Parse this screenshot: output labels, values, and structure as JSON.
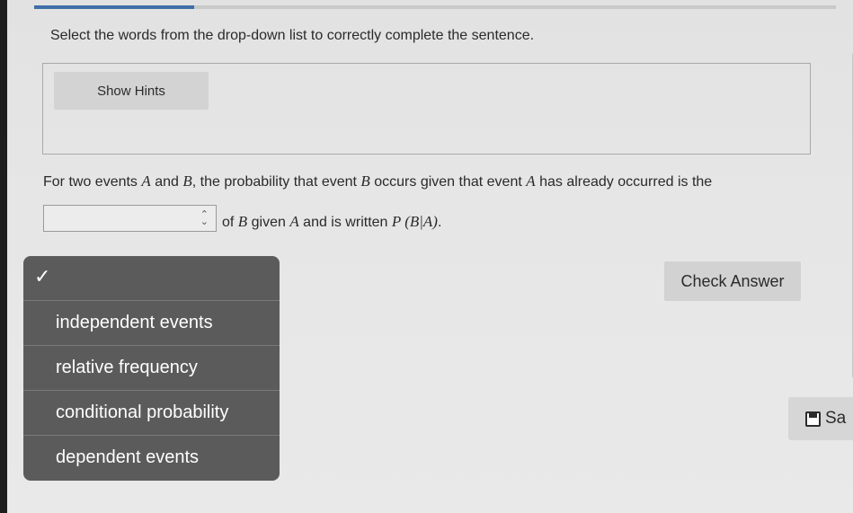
{
  "progress": {
    "fraction": 0.2
  },
  "instruction": "Select the words from the drop-down list to correctly complete the sentence.",
  "hints": {
    "button_label": "Show Hints"
  },
  "sentence": {
    "line1_a": "For two events ",
    "var_a": "A",
    "line1_b": " and ",
    "var_b": "B",
    "line1_c": ", the probability that event ",
    "var_b2": "B",
    "line1_d": " occurs given that event ",
    "var_a2": "A",
    "line1_e": " has already occurred is the",
    "line2_a": "of ",
    "var_b3": "B",
    "line2_b": " given ",
    "var_a3": "A",
    "line2_c": " and is written ",
    "notation": "P (B|A)",
    "line2_d": "."
  },
  "select": {
    "value": "",
    "icon": "updown-chevron-icon"
  },
  "dropdown": {
    "checkmark": "✓",
    "options": [
      "independent events",
      "relative frequency",
      "conditional probability",
      "dependent events"
    ]
  },
  "buttons": {
    "check_answer": "Check Answer",
    "save": "Sa"
  }
}
